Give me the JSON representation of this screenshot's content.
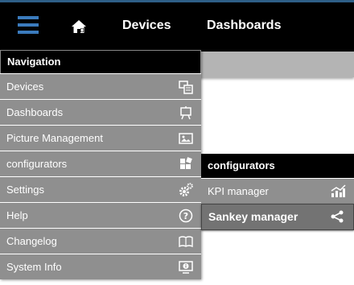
{
  "topbar": {
    "menu_icon": "hamburger-icon",
    "home_icon": "home-icon",
    "nav": [
      "Devices",
      "Dashboards"
    ],
    "accent": "#3b7bbd"
  },
  "navigation": {
    "title": "Navigation",
    "items": [
      {
        "label": "Devices",
        "icon": "devices-icon"
      },
      {
        "label": "Dashboards",
        "icon": "easel-icon"
      },
      {
        "label": "Picture Management",
        "icon": "picture-icon"
      },
      {
        "label": "configurators",
        "icon": "blocks-icon"
      },
      {
        "label": "Settings",
        "icon": "gears-icon"
      },
      {
        "label": "Help",
        "icon": "help-circle-icon"
      },
      {
        "label": "Changelog",
        "icon": "book-icon"
      },
      {
        "label": "System Info",
        "icon": "monitor-info-icon"
      }
    ]
  },
  "submenu": {
    "title": "configurators",
    "items": [
      {
        "label": "KPI manager",
        "icon": "chart-icon",
        "active": false
      },
      {
        "label": "Sankey manager",
        "icon": "share-icon",
        "active": true
      }
    ]
  }
}
